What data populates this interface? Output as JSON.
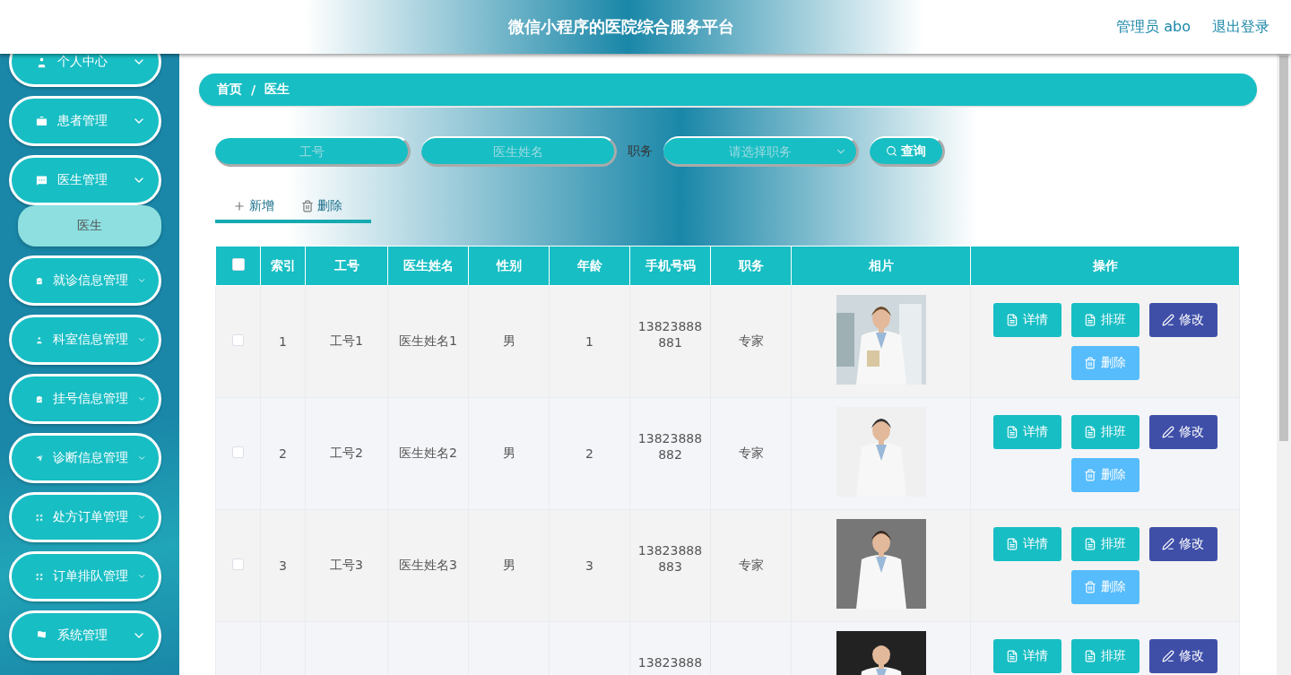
{
  "header": {
    "title": "微信小程序的医院综合服务平台",
    "user": "管理员 abo",
    "logout": "退出登录"
  },
  "sidebar": {
    "items": [
      {
        "label": "个人中心"
      },
      {
        "label": "患者管理"
      },
      {
        "label": "医生管理",
        "children": [
          {
            "label": "医生",
            "selected": true
          }
        ]
      },
      {
        "label": "就诊信息管理"
      },
      {
        "label": "科室信息管理"
      },
      {
        "label": "挂号信息管理"
      },
      {
        "label": "诊断信息管理"
      },
      {
        "label": "处方订单管理"
      },
      {
        "label": "订单排队管理"
      },
      {
        "label": "系统管理"
      }
    ]
  },
  "breadcrumb": [
    "首页",
    "/",
    "医生"
  ],
  "search": {
    "fields": [
      {
        "placeholder": "工号",
        "kind": "input"
      },
      {
        "placeholder": "医生姓名",
        "kind": "input"
      },
      {
        "label": "职务",
        "placeholder": "请选择职务",
        "kind": "select"
      }
    ],
    "button": "查询"
  },
  "actions": [
    {
      "label": "新增",
      "kind": "add"
    },
    {
      "label": "删除",
      "kind": "delete"
    }
  ],
  "table": {
    "header_checkbox": {
      "checked": false
    },
    "columns": [
      "索引",
      "工号",
      "医生姓名",
      "性别",
      "年龄",
      "手机号码",
      "职务",
      "相片",
      "操作"
    ],
    "rows": [
      {
        "checked": false,
        "cells": [
          "1",
          "工号1",
          "医生姓名1",
          "男",
          "1",
          "13823888 881",
          "专家"
        ],
        "photo": {
          "kind": "picture"
        },
        "buttons": [
          {
            "label": "详情",
            "kind": "detail"
          },
          {
            "label": "排班",
            "kind": "schedule"
          },
          {
            "label": "修改",
            "kind": "edit"
          },
          {
            "label": "删除",
            "kind": "delete"
          }
        ]
      },
      {
        "checked": false,
        "cells": [
          "2",
          "工号2",
          "医生姓名2",
          "男",
          "2",
          "13823888 882",
          "专家"
        ],
        "photo": {
          "kind": "picture"
        },
        "buttons": [
          {
            "label": "详情",
            "kind": "detail"
          },
          {
            "label": "排班",
            "kind": "schedule"
          },
          {
            "label": "修改",
            "kind": "edit"
          },
          {
            "label": "删除",
            "kind": "delete"
          }
        ]
      },
      {
        "checked": false,
        "cells": [
          "3",
          "工号3",
          "医生姓名3",
          "男",
          "3",
          "13823888 883",
          "专家"
        ],
        "photo": {
          "kind": "picture"
        },
        "buttons": [
          {
            "label": "详情",
            "kind": "detail"
          },
          {
            "label": "排班",
            "kind": "schedule"
          },
          {
            "label": "修改",
            "kind": "edit"
          },
          {
            "label": "删除",
            "kind": "delete"
          }
        ]
      },
      {
        "cells": [
          "",
          "",
          "",
          "",
          "",
          "13823888",
          ""
        ],
        "photo": {
          "kind": "picture"
        },
        "buttons": [
          {
            "label": "详情",
            "kind": "detail"
          },
          {
            "label": "排班",
            "kind": "schedule"
          },
          {
            "label": "修改",
            "kind": "edit"
          }
        ]
      }
    ]
  }
}
